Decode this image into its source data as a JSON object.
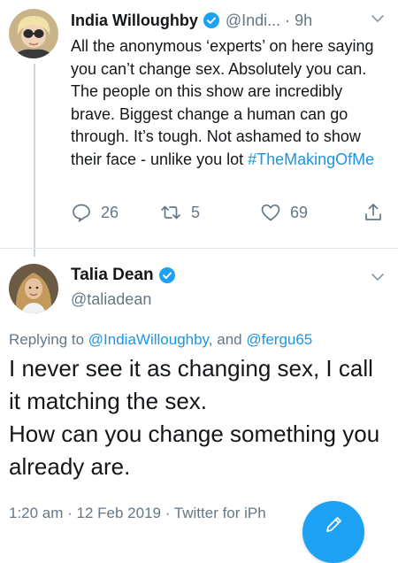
{
  "tweet1": {
    "name": "India Willoughby",
    "handle": "@Indi...",
    "separator": "·",
    "time": "9h",
    "text_before_hashtag": "All the anonymous ‘experts’ on here saying you can’t change sex. Absolutely you can. The people on this show are incredibly brave. Biggest change a human can go through. It’s tough. Not ashamed to show their face - unlike you lot ",
    "hashtag": "#TheMakingOfMe",
    "reply_count": "26",
    "retweet_count": "5",
    "like_count": "69"
  },
  "tweet2": {
    "name": "Talia Dean",
    "handle": "@taliadean",
    "replying_prefix": "Replying to ",
    "mention1": "@IndiaWilloughby",
    "replying_and": ", and ",
    "mention2": "@fergu65",
    "line1": "I never see it as changing sex, I call it matching the sex.",
    "line2": "How can you change something you already are.",
    "meta": "1:20 am · 12 Feb 2019 · Twitter for iPh"
  },
  "colors": {
    "link_blue": "#1b95e0",
    "muted_gray": "#657786",
    "verified_blue": "#1da1f2",
    "fab_blue": "#1da1f2"
  },
  "icons": [
    "verified-badge-icon",
    "chevron-down-icon",
    "reply-icon",
    "retweet-icon",
    "like-icon",
    "share-icon",
    "compose-icon"
  ]
}
